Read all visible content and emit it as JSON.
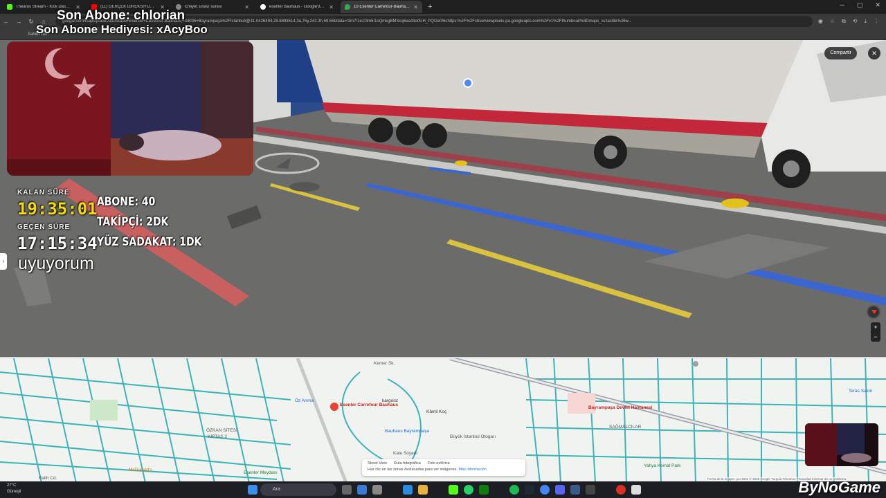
{
  "browser": {
    "tabs": [
      {
        "title": "Thearus Stream - Kick Dashboard",
        "color": "#53fc18"
      },
      {
        "title": "(11) GERÇEK DİREKSİYON SINAVI",
        "color": "#ff0000"
      },
      {
        "title": "Ehliyet sınavı süresi",
        "color": "#888888"
      },
      {
        "title": "esenler bauhaus - Google'da Ara",
        "color": "#ffffff"
      },
      {
        "title": "10 Esenler Carrefour-Bauhaus - G",
        "color": "#34a853"
      }
    ],
    "url": "google.com/maps/place/Altunizade+Esenler+Carrefour-Bauhaus,+34035+Bayrampaşa%2Fİstanbul/@41.0426494,28.8893514,3a,75y,242.3h,59.55t/data=!3m7!1e1!3m5!1sQmkgBMScq6ea43o0UH_PQ!2e0!6shttps:%2F%2Fstreetviewpixels-pa.googleapis.com%2Fv1%2Fthumbnail%3Dmaps_sv.tactile%26w...",
    "bookmark": "Sahibinden"
  },
  "streetview": {
    "share_label": "Compartir",
    "close_label": "✕"
  },
  "overlay": {
    "last_sub": "Son Abone: chlorian",
    "last_gift": "Son Abone Hediyesi: xAcyBoo",
    "remaining_label": "KALAN SÜRE",
    "remaining_time": "19:35:01",
    "elapsed_label": "GEÇEN SÜRE",
    "elapsed_time": "17:15:34",
    "stat_sub": "ABONE: 40",
    "stat_follow": "TAKİPÇİ: 2DK",
    "stat_loyalty": "YÜZ SADAKAT: 1DK",
    "status": "uyuyorum",
    "timer_color": "#f5d90a"
  },
  "map": {
    "place_name": "Esenler Carrefour Bauhaus",
    "labels": {
      "kargoist": "kargoist",
      "kamil_koc": "Kâmil Koç",
      "bauhaus": "Bauhaus Bayrampaşa",
      "otogar": "Büyük İstanbul Otogarı",
      "hospital": "Bayrampaşa Devlet Hastanesi",
      "sagmalcilar": "SAĞMALCILAR",
      "kemer": "Kemer Sk.",
      "oz_arena": "Öz Arena",
      "teras_salon": "Teras Salon",
      "kale": "Kale Soyadı",
      "fatih": "Fatih Cd.",
      "esenler_meydan": "Esenler Meydanı",
      "yahya": "Yahya Kemal Park",
      "kiptas": "KİPTAŞ 2",
      "ozkan": "ÖZKAN SİTESİ",
      "mcdonalds": "McDonald's"
    },
    "layers": {
      "street_view": "Street View",
      "photo_route": "Ruta fotográfica",
      "photo_sphere": "Foto esférica",
      "hint": "Haz clic en las zonas destacadas para ver imágenes.",
      "more_info": "Más información"
    },
    "attribution": "Fecha de la imagen: jun 2022   © 2025 Google   Turquía   Términos   Privacidad   Informar de un problema"
  },
  "taskbar": {
    "temperature": "27°C",
    "weather": "Güneşli",
    "search_placeholder": "Ara"
  },
  "branding": {
    "name": "ByNoGame"
  }
}
